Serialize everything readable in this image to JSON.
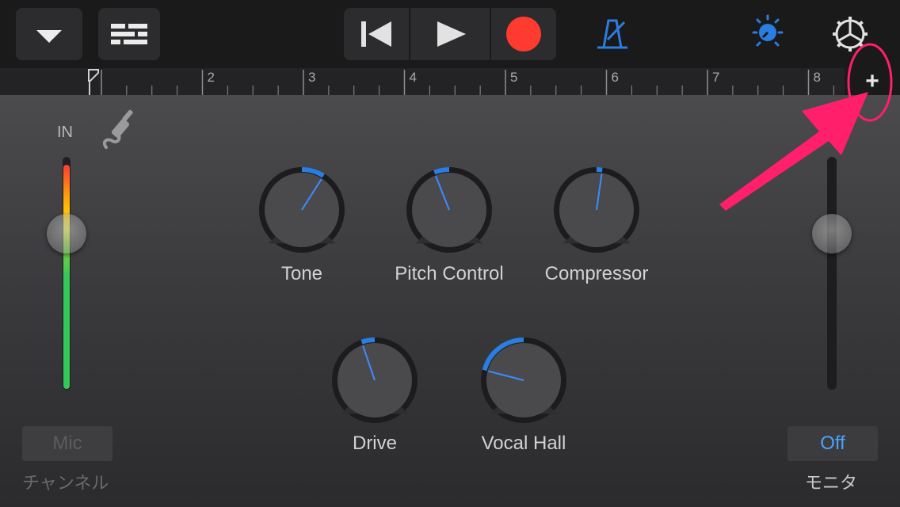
{
  "toolbar": {
    "menu_icon": "chevron-down-icon",
    "tracks_icon": "tracks-view-icon",
    "rewind_icon": "skip-back-icon",
    "play_icon": "play-icon",
    "record_icon": "record-icon",
    "metronome_icon": "metronome-icon",
    "master_icon": "master-effects-icon",
    "settings_icon": "gear-icon",
    "record_color": "#ff3b30",
    "accent_color": "#2a7de1"
  },
  "ruler": {
    "bars": [
      "2",
      "3",
      "4",
      "5",
      "6",
      "7",
      "8"
    ],
    "add_label": "+"
  },
  "input": {
    "label": "IN",
    "jack_icon": "input-jack-icon",
    "channel_button": "Mic",
    "channel_caption": "チャンネル"
  },
  "knobs": [
    {
      "label": "Tone",
      "value": 0.62
    },
    {
      "label": "Pitch Control",
      "value": 0.42
    },
    {
      "label": "Compressor",
      "value": 0.53
    },
    {
      "label": "Drive",
      "value": 0.43
    },
    {
      "label": "Vocal Hall",
      "value": 0.22
    }
  ],
  "monitor": {
    "button": "Off",
    "caption": "モニタ",
    "level": 0.67
  },
  "input_level": 0.67,
  "annotation": {
    "color": "#ff1f6a"
  }
}
